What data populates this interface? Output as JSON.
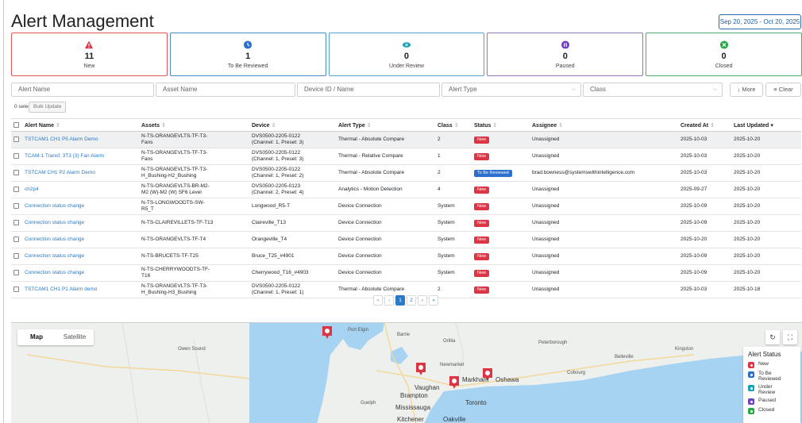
{
  "header": {
    "title": "Alert Management",
    "date_range": "Sep 20, 2025 - Oct 20, 2025 ▾"
  },
  "cards": [
    {
      "key": "new",
      "value": "11",
      "label": "New",
      "color": "#dc3545",
      "icon": "warning-icon"
    },
    {
      "key": "review",
      "value": "1",
      "label": "To Be Reviewed",
      "color": "#2d6fcc",
      "icon": "clock-icon"
    },
    {
      "key": "under",
      "value": "0",
      "label": "Under Review",
      "color": "#17a2b8",
      "icon": "eye-icon"
    },
    {
      "key": "paused",
      "value": "0",
      "label": "Paused",
      "color": "#6f42c1",
      "icon": "pause-icon"
    },
    {
      "key": "closed",
      "value": "0",
      "label": "Closed",
      "color": "#28a745",
      "icon": "check-circle-icon"
    }
  ],
  "filters": {
    "alert_name": "Alert Name",
    "asset_name": "Asset Name",
    "device": "Device ID / Name",
    "alert_type": "Alert Type",
    "class": "Class",
    "more": "↓ More",
    "clear": "≡ Clear"
  },
  "selection": {
    "text": "0 selected",
    "bulk_update": "Bulk Update"
  },
  "table": {
    "headers": [
      "Alert Name",
      "Assets",
      "Device",
      "Alert Type",
      "Class",
      "Status",
      "Assignee",
      "Created At",
      "Last Updated"
    ],
    "last_updated_sort": "▾",
    "rows": [
      {
        "name": "TSTCAM1 CH1 P5 Alarm Demo",
        "asset1": "N-TS-ORANGEVLTS-TF-T3-",
        "asset2": "Fans",
        "device1": "DVS0500-2205-0122",
        "device2": "(Channel: 1, Preset: 3)",
        "type": "Thermal - Absolute Compare",
        "class": "2",
        "status": "New",
        "assignee": "Unassigned",
        "created": "2025-10-03",
        "updated": "2025-10-20"
      },
      {
        "name": "TCAM-1 Transf. 3T3 (3) Fan Alarm",
        "asset1": "N-TS-ORANGEVLTS-TF-T3-",
        "asset2": "Fans",
        "device1": "DVS0500-2205-0122",
        "device2": "(Channel: 1, Preset: 3)",
        "type": "Thermal - Relative Compare",
        "class": "1",
        "status": "New",
        "assignee": "Unassigned",
        "created": "2025-10-03",
        "updated": "2025-10-20"
      },
      {
        "name": "TSTCAM CH1 P2 Alarm Demo",
        "asset1": "N-TS-ORANGEVLTS-TF-T3-",
        "asset2": "H_Bushing-H2_Bushing",
        "device1": "DVS0500-2205-0122",
        "device2": "(Channel: 1, Preset: 2)",
        "type": "Thermal - Absolute Compare",
        "class": "2",
        "status": "To Be Reviewed",
        "assignee": "brad.bowness@systemswithintelligence.com",
        "created": "2025-10-03",
        "updated": "2025-10-20"
      },
      {
        "name": "ch2p4",
        "asset1": "N-TS-ORANGEVLTS-BR-M2-",
        "asset2": "M2 (W)-M2 (W) SF6 Level",
        "device1": "DVS0500-2205-0123",
        "device2": "(Channel: 2, Preset: 4)",
        "type": "Analytics - Motion Detection",
        "class": "4",
        "status": "New",
        "assignee": "Unassigned",
        "created": "2025-09-27",
        "updated": "2025-10-20"
      },
      {
        "name": "Connection status change",
        "asset1": "N-TS-LONGWOODTS-SW-",
        "asset2": "R5_T",
        "device1": "Longwood_R5-T",
        "device2": "",
        "type": "Device Connection",
        "class": "System",
        "status": "New",
        "assignee": "Unassigned",
        "created": "2025-10-09",
        "updated": "2025-10-20"
      },
      {
        "name": "Connection status change",
        "asset1": "N-TS-CLAIREVILLETS-TF-T13",
        "asset2": "",
        "device1": "Claireville_T13",
        "device2": "",
        "type": "Device Connection",
        "class": "System",
        "status": "New",
        "assignee": "Unassigned",
        "created": "2025-10-09",
        "updated": "2025-10-20"
      },
      {
        "name": "Connection status change",
        "asset1": "N-TS-ORANGEVLTS-TF-T4",
        "asset2": "",
        "device1": "Orangeville_T4",
        "device2": "",
        "type": "Device Connection",
        "class": "System",
        "status": "New",
        "assignee": "Unassigned",
        "created": "2025-10-20",
        "updated": "2025-10-20"
      },
      {
        "name": "Connection status change",
        "asset1": "N-TS-BRUCETS-TF-T25",
        "asset2": "",
        "device1": "Bruce_T25_#4901",
        "device2": "",
        "type": "Device Connection",
        "class": "System",
        "status": "New",
        "assignee": "Unassigned",
        "created": "2025-10-09",
        "updated": "2025-10-20"
      },
      {
        "name": "Connection status change",
        "asset1": "N-TS-CHERRYWOODTS-TF-",
        "asset2": "T16",
        "device1": "Cherrywood_T16_#4903",
        "device2": "",
        "type": "Device Connection",
        "class": "System",
        "status": "New",
        "assignee": "Unassigned",
        "created": "2025-10-09",
        "updated": "2025-10-20"
      },
      {
        "name": "TSTCAM1 CH1 P1 Alarm demo",
        "asset1": "N-TS-ORANGEVLTS-TF-T3-",
        "asset2": "H_Bushing-H3_Bushing",
        "device1": "DVS0500-2205-0122",
        "device2": "(Channel: 1, Preset: 1)",
        "type": "Thermal - Absolute Compare",
        "class": "2",
        "status": "New",
        "assignee": "Unassigned",
        "created": "2025-10-03",
        "updated": "2025-10-18"
      }
    ]
  },
  "pagination": {
    "first": "«",
    "prev": "‹",
    "pages": [
      "1",
      "2"
    ],
    "next": "›",
    "last": "»"
  },
  "map": {
    "tab_map": "Map",
    "tab_satellite": "Satellite",
    "legend_title": "Alert Status",
    "legend": [
      {
        "label": "New",
        "color": "#dc3545"
      },
      {
        "label": "To Be Reviewed",
        "color": "#2d6fcc"
      },
      {
        "label": "Under Review",
        "color": "#17a2b8"
      },
      {
        "label": "Paused",
        "color": "#6f42c1"
      },
      {
        "label": "Closed",
        "color": "#28a745"
      }
    ],
    "places": {
      "barrie": "Barrie",
      "vaughan": "Vaughan",
      "markham": "Markham",
      "brampton": "Brampton",
      "toronto": "Toronto",
      "mississauga": "Mississauga",
      "oshawa": "Oshawa",
      "kitchener": "Kitchener",
      "oakville": "Oakville",
      "newmarket": "Newmarket",
      "kingston": "Kingston",
      "peterborough": "Peterborough",
      "owen_sound": "Owen Sound",
      "port_elgin": "Port Elgin",
      "orillia": "Orillia",
      "belleville": "Belleville",
      "cobourg": "Cobourg",
      "guelph": "Guelph"
    }
  }
}
